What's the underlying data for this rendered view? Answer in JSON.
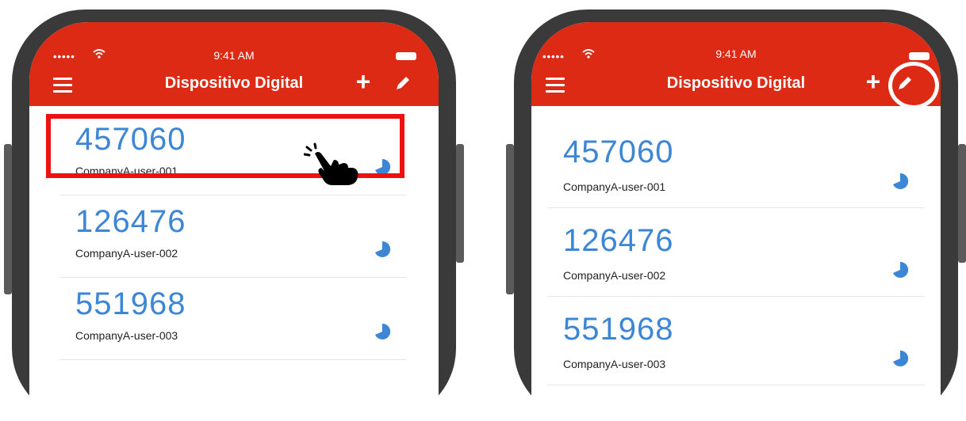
{
  "screens": [
    {
      "status_bar": {
        "signal": "•••••",
        "time": "9:41 AM"
      },
      "header": {
        "title": "Dispositivo Digital"
      },
      "accounts": [
        {
          "code": "457060",
          "user": "CompanyA-user-001"
        },
        {
          "code": "126476",
          "user": "CompanyA-user-002"
        },
        {
          "code": "551968",
          "user": "CompanyA-user-003"
        }
      ]
    },
    {
      "status_bar": {
        "signal": "•••••",
        "time": "9:41 AM"
      },
      "header": {
        "title": "Dispositivo Digital"
      },
      "accounts": [
        {
          "code": "457060",
          "user": "CompanyA-user-001"
        },
        {
          "code": "126476",
          "user": "CompanyA-user-002"
        },
        {
          "code": "551968",
          "user": "CompanyA-user-003"
        }
      ]
    }
  ],
  "colors": {
    "header_bg": "#dc2a15",
    "code_text": "#3d86d6",
    "timer": "#3d86d6",
    "highlight_box": "#ee1111",
    "phone_frame": "#3a3a3a"
  },
  "icons": {
    "menu": "hamburger-menu-icon",
    "add": "plus-icon",
    "edit": "pencil-icon",
    "timer": "countdown-pie-icon",
    "tap": "tapping-hand-icon",
    "wifi": "wifi-icon",
    "battery": "battery-icon"
  }
}
